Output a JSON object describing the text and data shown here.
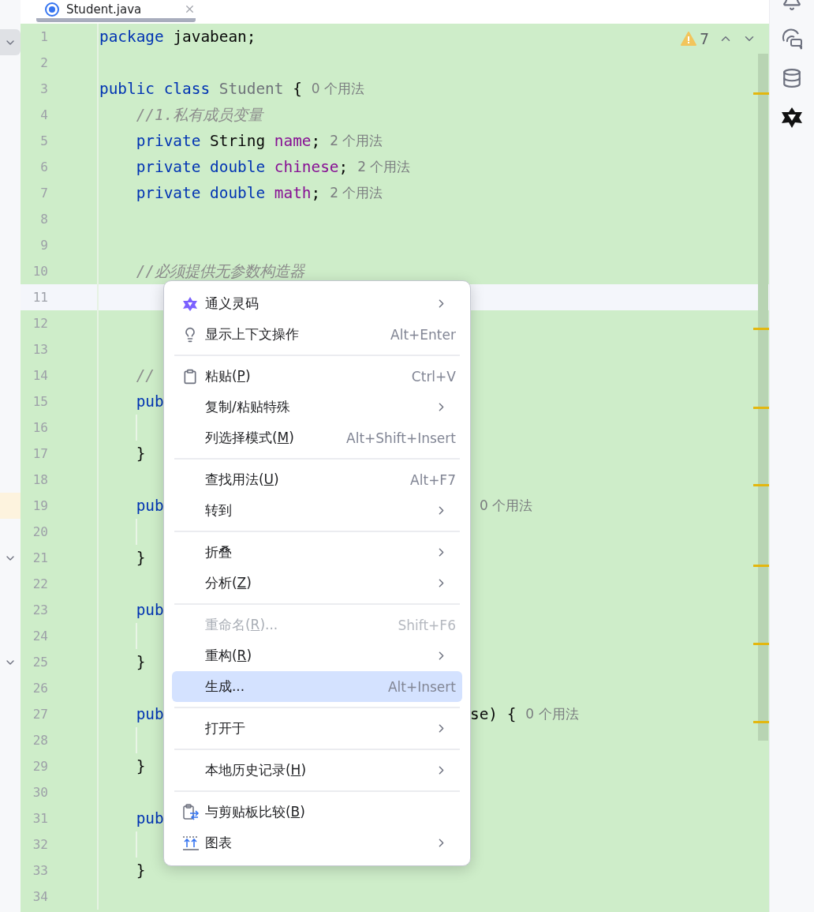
{
  "tab": {
    "title": "Student.java",
    "selected": true
  },
  "inspection": {
    "count": "7"
  },
  "rows": [
    {
      "number": "1",
      "current": false,
      "fold": true,
      "marked": false,
      "guide": false,
      "code": [
        {
          "kind": "keyword",
          "text": "package"
        },
        {
          "kind": "plain",
          "text": " javabean;"
        }
      ]
    },
    {
      "number": "2",
      "current": false,
      "fold": false,
      "marked": false,
      "guide": false,
      "code": []
    },
    {
      "number": "3",
      "current": false,
      "fold": false,
      "marked": false,
      "guide": false,
      "code": [
        {
          "kind": "keyword",
          "text": "public class "
        },
        {
          "kind": "class",
          "text": "Student"
        },
        {
          "kind": "plain",
          "text": " {"
        },
        {
          "kind": "hint",
          "text": "0 个用法"
        }
      ]
    },
    {
      "number": "4",
      "current": false,
      "fold": false,
      "marked": false,
      "guide": false,
      "code": [
        {
          "kind": "comment",
          "text": "    //1.私有成员变量"
        }
      ]
    },
    {
      "number": "5",
      "current": false,
      "fold": false,
      "marked": false,
      "guide": false,
      "code": [
        {
          "kind": "keyword",
          "text": "    private "
        },
        {
          "kind": "plain",
          "text": "String "
        },
        {
          "kind": "field",
          "text": "name"
        },
        {
          "kind": "plain",
          "text": ";"
        },
        {
          "kind": "hint",
          "text": "2 个用法"
        }
      ]
    },
    {
      "number": "6",
      "current": false,
      "fold": false,
      "marked": false,
      "guide": false,
      "code": [
        {
          "kind": "keyword",
          "text": "    private double "
        },
        {
          "kind": "field",
          "text": "chinese"
        },
        {
          "kind": "plain",
          "text": ";"
        },
        {
          "kind": "hint",
          "text": "2 个用法"
        }
      ]
    },
    {
      "number": "7",
      "current": false,
      "fold": false,
      "marked": false,
      "guide": false,
      "code": [
        {
          "kind": "keyword",
          "text": "    private double "
        },
        {
          "kind": "field",
          "text": "math"
        },
        {
          "kind": "plain",
          "text": ";"
        },
        {
          "kind": "hint",
          "text": "2 个用法"
        }
      ]
    },
    {
      "number": "8",
      "current": false,
      "fold": false,
      "marked": false,
      "guide": false,
      "code": []
    },
    {
      "number": "9",
      "current": false,
      "fold": false,
      "marked": false,
      "guide": false,
      "code": []
    },
    {
      "number": "10",
      "current": false,
      "fold": false,
      "marked": false,
      "guide": false,
      "code": [
        {
          "kind": "comment",
          "text": "    //必须提供无参数构造器"
        }
      ]
    },
    {
      "number": "11",
      "current": true,
      "fold": false,
      "marked": false,
      "guide": false,
      "code": []
    },
    {
      "number": "12",
      "current": false,
      "fold": false,
      "marked": false,
      "guide": false,
      "code": []
    },
    {
      "number": "13",
      "current": false,
      "fold": false,
      "marked": false,
      "guide": false,
      "code": []
    },
    {
      "number": "14",
      "current": false,
      "fold": false,
      "marked": false,
      "guide": false,
      "code": [
        {
          "kind": "comment",
          "text": "    //"
        }
      ]
    },
    {
      "number": "15",
      "current": false,
      "fold": false,
      "marked": false,
      "guide": false,
      "code": [
        {
          "kind": "keyword",
          "text": "    pub"
        }
      ]
    },
    {
      "number": "16",
      "current": false,
      "fold": false,
      "marked": false,
      "guide": true,
      "code": []
    },
    {
      "number": "17",
      "current": false,
      "fold": false,
      "marked": false,
      "guide": false,
      "code": [
        {
          "kind": "plain",
          "text": "    }"
        }
      ]
    },
    {
      "number": "18",
      "current": false,
      "fold": false,
      "marked": false,
      "guide": false,
      "code": []
    },
    {
      "number": "19",
      "current": false,
      "fold": false,
      "marked": true,
      "guide": false,
      "code": [
        {
          "kind": "keyword",
          "text": "    pub"
        }
      ],
      "code_right": [
        {
          "kind": "hint",
          "text": "0 个用法"
        }
      ]
    },
    {
      "number": "20",
      "current": false,
      "fold": false,
      "marked": false,
      "guide": true,
      "code": []
    },
    {
      "number": "21",
      "current": false,
      "fold": true,
      "marked": false,
      "guide": false,
      "code": [
        {
          "kind": "plain",
          "text": "    }"
        }
      ]
    },
    {
      "number": "22",
      "current": false,
      "fold": false,
      "marked": false,
      "guide": false,
      "code": []
    },
    {
      "number": "23",
      "current": false,
      "fold": false,
      "marked": false,
      "guide": false,
      "code": [
        {
          "kind": "keyword",
          "text": "    pub"
        }
      ]
    },
    {
      "number": "24",
      "current": false,
      "fold": false,
      "marked": false,
      "guide": true,
      "code": []
    },
    {
      "number": "25",
      "current": false,
      "fold": true,
      "marked": false,
      "guide": false,
      "code": [
        {
          "kind": "plain",
          "text": "    }"
        }
      ]
    },
    {
      "number": "26",
      "current": false,
      "fold": false,
      "marked": false,
      "guide": false,
      "code": []
    },
    {
      "number": "27",
      "current": false,
      "fold": false,
      "marked": false,
      "guide": false,
      "code": [
        {
          "kind": "keyword",
          "text": "    pub"
        }
      ],
      "code_right": [
        {
          "kind": "plain",
          "text": "se) {"
        },
        {
          "kind": "hint",
          "text": "0 个用法"
        }
      ]
    },
    {
      "number": "28",
      "current": false,
      "fold": false,
      "marked": false,
      "guide": true,
      "code": []
    },
    {
      "number": "29",
      "current": false,
      "fold": false,
      "marked": false,
      "guide": false,
      "code": [
        {
          "kind": "plain",
          "text": "    }"
        }
      ]
    },
    {
      "number": "30",
      "current": false,
      "fold": false,
      "marked": false,
      "guide": false,
      "code": []
    },
    {
      "number": "31",
      "current": false,
      "fold": false,
      "marked": false,
      "guide": false,
      "code": [
        {
          "kind": "keyword",
          "text": "    pub"
        }
      ]
    },
    {
      "number": "32",
      "current": false,
      "fold": false,
      "marked": false,
      "guide": true,
      "code": []
    },
    {
      "number": "33",
      "current": false,
      "fold": false,
      "marked": false,
      "guide": false,
      "code": [
        {
          "kind": "plain",
          "text": "    }"
        }
      ]
    },
    {
      "number": "34",
      "current": false,
      "fold": false,
      "marked": false,
      "guide": false,
      "code": []
    }
  ],
  "context_menu": {
    "groups": [
      [
        {
          "label": "通义灵码",
          "submenu": true,
          "disabled": false,
          "selected": false
        },
        {
          "label": "显示上下文操作",
          "shortcut": "Alt+Enter",
          "submenu": false,
          "disabled": false,
          "selected": false
        }
      ],
      [
        {
          "label": "粘贴(",
          "mnemonic": "P",
          "suffix": ")",
          "shortcut": "Ctrl+V",
          "submenu": false,
          "disabled": false,
          "selected": false
        },
        {
          "label": "复制/粘贴特殊",
          "submenu": true,
          "disabled": false,
          "selected": false
        },
        {
          "label": "列选择模式(",
          "mnemonic": "M",
          "suffix": ")",
          "shortcut": "Alt+Shift+Insert",
          "submenu": false,
          "disabled": false,
          "selected": false
        }
      ],
      [
        {
          "label": "查找用法(",
          "mnemonic": "U",
          "suffix": ")",
          "shortcut": "Alt+F7",
          "submenu": false,
          "disabled": false,
          "selected": false
        },
        {
          "label": "转到",
          "submenu": true,
          "disabled": false,
          "selected": false
        }
      ],
      [
        {
          "label": "折叠",
          "submenu": true,
          "disabled": false,
          "selected": false
        },
        {
          "label": "分析(",
          "mnemonic": "Z",
          "suffix": ")",
          "submenu": true,
          "disabled": false,
          "selected": false
        }
      ],
      [
        {
          "label": "重命名(",
          "mnemonic": "R",
          "suffix": ")...",
          "shortcut": "Shift+F6",
          "submenu": false,
          "disabled": true,
          "selected": false
        },
        {
          "label": "重构(",
          "mnemonic": "R",
          "suffix": ")",
          "submenu": true,
          "disabled": false,
          "selected": false
        },
        {
          "label": "生成...",
          "shortcut": "Alt+Insert",
          "submenu": false,
          "disabled": false,
          "selected": true
        }
      ],
      [
        {
          "label": "打开于",
          "submenu": true,
          "disabled": false,
          "selected": false
        }
      ],
      [
        {
          "label": "本地历史记录(",
          "mnemonic": "H",
          "suffix": ")",
          "submenu": true,
          "disabled": false,
          "selected": false
        }
      ],
      [
        {
          "label": "与剪贴板比较(",
          "mnemonic": "B",
          "suffix": ")",
          "submenu": false,
          "disabled": false,
          "selected": false
        },
        {
          "label": "图表",
          "submenu": true,
          "disabled": false,
          "selected": false
        }
      ]
    ]
  }
}
